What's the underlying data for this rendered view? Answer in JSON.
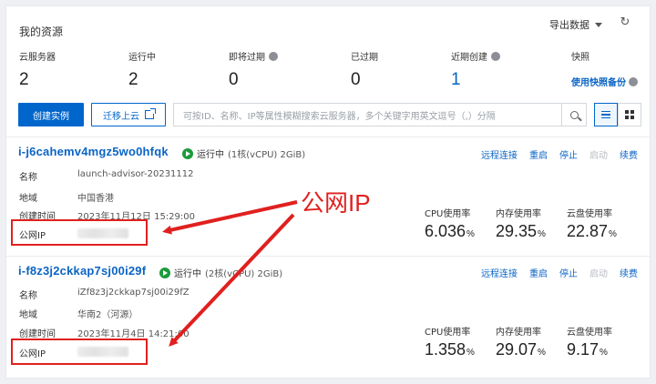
{
  "header": {
    "title": "我的资源",
    "export_label": "导出数据"
  },
  "stats": [
    {
      "label": "云服务器",
      "value": "2",
      "help": false
    },
    {
      "label": "运行中",
      "value": "2",
      "help": false
    },
    {
      "label": "即将过期",
      "value": "0",
      "help": true
    },
    {
      "label": "已过期",
      "value": "0",
      "help": false
    },
    {
      "label": "近期创建",
      "value": "1",
      "help": true
    },
    {
      "label": "快照",
      "link": "使用快照备份",
      "help": true
    }
  ],
  "toolbar": {
    "create_label": "创建实例",
    "migrate_label": "迁移上云",
    "search_placeholder": "可按ID、名称、IP等属性模糊搜索云服务器，多个关键字用英文逗号（,）分隔"
  },
  "field_labels": {
    "name": "名称",
    "region": "地域",
    "created": "创建时间",
    "public_ip": "公网IP"
  },
  "metric_labels": {
    "cpu": "CPU使用率",
    "mem": "内存使用率",
    "disk": "云盘使用率"
  },
  "actions": {
    "remote": "远程连接",
    "restart": "重启",
    "stop": "停止",
    "start": "启动",
    "renew": "续费"
  },
  "instances": [
    {
      "id": "i-j6cahemv4mgz5wo0hfqk",
      "status": "运行中",
      "spec": "(1核(vCPU) 2GiB)",
      "name": "launch-advisor-20231112",
      "region": "中国香港",
      "created": "2023年11月12日 15:29:00",
      "cpu": "6.036",
      "mem": "29.35",
      "disk": "22.87",
      "pct": "%"
    },
    {
      "id": "i-f8z3j2ckkap7sj00i29f",
      "status": "运行中",
      "spec": "(2核(vCPU) 2GiB)",
      "name": "iZf8z3j2ckkap7sj00i29fZ",
      "region": "华南2（河源）",
      "created": "2023年11月4日 14:21:00",
      "cpu": "1.358",
      "mem": "29.07",
      "disk": "9.17",
      "pct": "%"
    }
  ],
  "annotation": {
    "text": "公网IP",
    "color": "#e0201f"
  },
  "colors": {
    "primary": "#0066cc",
    "link": "#0a64c4",
    "running": "#1c9a3c",
    "disabled": "#b7bbc0"
  }
}
